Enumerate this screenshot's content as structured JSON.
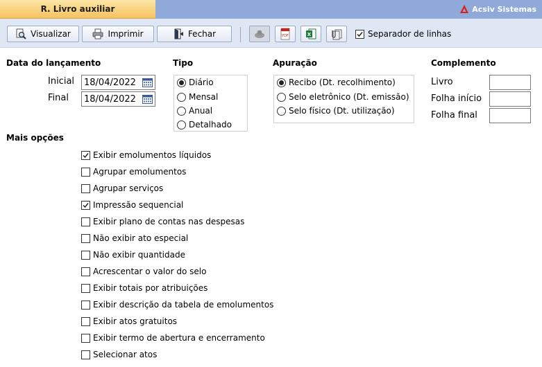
{
  "title": "R. Livro auxiliar",
  "brand": "Acsiv Sistemas",
  "toolbar": {
    "visualizar": "Visualizar",
    "imprimir": "Imprimir",
    "fechar": "Fechar",
    "separador": "Separador de linhas",
    "separador_checked": true
  },
  "data_lancamento": {
    "heading": "Data do lançamento",
    "inicial_label": "Inicial",
    "inicial_value": "18/04/2022",
    "final_label": "Final",
    "final_value": "18/04/2022"
  },
  "tipo": {
    "heading": "Tipo",
    "options": [
      "Diário",
      "Mensal",
      "Anual",
      "Detalhado"
    ],
    "selected": "Diário"
  },
  "apuracao": {
    "heading": "Apuração",
    "options": [
      "Recibo (Dt. recolhimento)",
      "Selo eletrônico (Dt. emissão)",
      "Selo físico (Dt. utilização)"
    ],
    "selected": "Recibo (Dt. recolhimento)"
  },
  "complemento": {
    "heading": "Complemento",
    "livro": "Livro",
    "folha_inicio": "Folha início",
    "folha_final": "Folha final"
  },
  "mais_opcoes": {
    "heading": "Mais opções",
    "items": [
      {
        "label": "Exibir emolumentos líquidos",
        "checked": true
      },
      {
        "label": "Agrupar emolumentos",
        "checked": false
      },
      {
        "label": "Agrupar serviços",
        "checked": false
      },
      {
        "label": "Impressão sequencial",
        "checked": true
      },
      {
        "label": "Exibir plano de contas nas despesas",
        "checked": false
      },
      {
        "label": "Não exibir ato especial",
        "checked": false
      },
      {
        "label": "Não exibir quantidade",
        "checked": false
      },
      {
        "label": "Acrescentar o valor do selo",
        "checked": false
      },
      {
        "label": "Exibir totais por atribuições",
        "checked": false
      },
      {
        "label": "Exibir descrição da tabela de emolumentos",
        "checked": false
      },
      {
        "label": "Exibir atos gratuitos",
        "checked": false
      },
      {
        "label": "Exibir termo de abertura e encerramento",
        "checked": false
      },
      {
        "label": "Selecionar atos",
        "checked": false
      }
    ]
  }
}
